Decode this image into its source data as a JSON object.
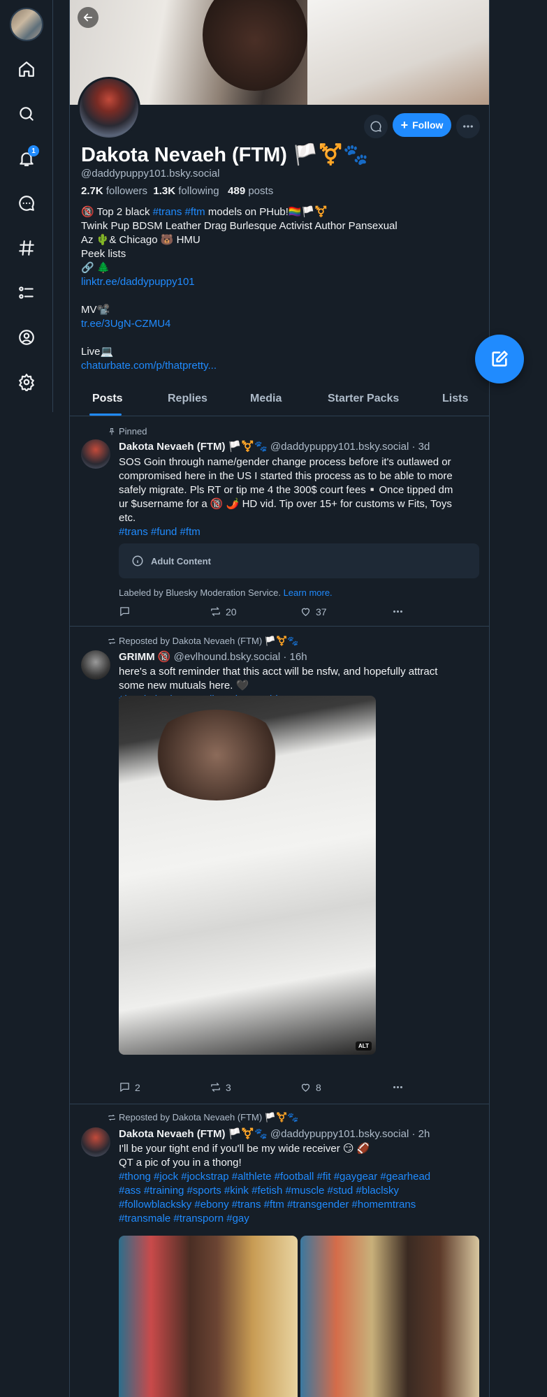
{
  "profile": {
    "display_name": "Dakota Nevaeh (FTM) 🏳️⚧️🐾",
    "handle": "@daddypuppy101.bsky.social",
    "followers_count": "2.7K",
    "followers_label": " followers",
    "following_count": "1.3K",
    "following_label": " following",
    "posts_count": "489",
    "posts_label": " posts",
    "follow_label": "Follow",
    "bio": {
      "l1_pre": "🔞 Top 2 black ",
      "l1_tag1": "#trans",
      "l1_tag2": "#ftm",
      "l1_post": " models on PHub!🏳️‍🌈🏳️⚧️",
      "l2": "Twink Pup BDSM Leather Drag Burlesque Activist Author Pansexual",
      "l3": "Az 🌵& Chicago 🐻 HMU",
      "l4": "Peek lists",
      "l5": "🔗 🌲",
      "link1": "linktr.ee/daddypuppy101",
      "l7": "MV📽️",
      "link2": "tr.ee/3UgN-CZMU4",
      "l10": "Live💻",
      "link3": "chaturbate.com/p/thatpretty..."
    }
  },
  "tabs": [
    "Posts",
    "Replies",
    "Media",
    "Starter Packs",
    "Lists"
  ],
  "notifications_badge": "1",
  "posts": [
    {
      "meta": "Pinned",
      "author": "Dakota Nevaeh (FTM) 🏳️⚧️🐾",
      "handle_time": " @daddypuppy101.bsky.social · 3d",
      "lines": [
        "SOS Goin through name/gender change process before it's outlawed or",
        "compromised here in the US I started this process as to be able to more",
        "safely migrate. Pls RT or tip me 4 the 300$ court fees▫️Once tipped dm",
        "ur $username for a 🔞 🌶️ HD vid. Tip over 15+ for customs w Fits, Toys",
        "etc."
      ],
      "tags": "#trans #fund #ftm",
      "adult_label": "Adult Content",
      "labeled_by": "Labeled by Bluesky Moderation Service. ",
      "learn_more": "Learn more.",
      "replies": "",
      "reposts": "20",
      "likes": "37"
    },
    {
      "meta": "Reposted by Dakota Nevaeh (FTM) 🏳️⚧️🐾",
      "author": "GRIMM 🔞",
      "handle_time": " @evlhound.bsky.social · 16h",
      "lines": [
        "here's a soft reminder that this acct will be nsfw, and hopefully attract",
        "some new mutuals here. 🖤"
      ],
      "tags": "#lewd #burlesque #lingerie #nonbinary",
      "alt": "ALT",
      "replies": "2",
      "reposts": "3",
      "likes": "8"
    },
    {
      "meta": "Reposted by Dakota Nevaeh (FTM) 🏳️⚧️🐾",
      "author": "Dakota Nevaeh (FTM) 🏳️⚧️🐾",
      "handle_time": " @daddypuppy101.bsky.social · 2h",
      "lines": [
        "I'll be your tight end if you'll be my wide receiver 😏 🏈",
        "QT a pic of you in a thong!"
      ],
      "tag_lines": [
        "#thong #jock #jockstrap #althlete #football #fit #gaygear #gearhead",
        "#ass #training #sports #kink #fetish #muscle #stud #blaclsky",
        "#followblacksky #ebony #trans #ftm #transgender #homemtrans",
        "#transmale #transporn #gay"
      ]
    }
  ]
}
